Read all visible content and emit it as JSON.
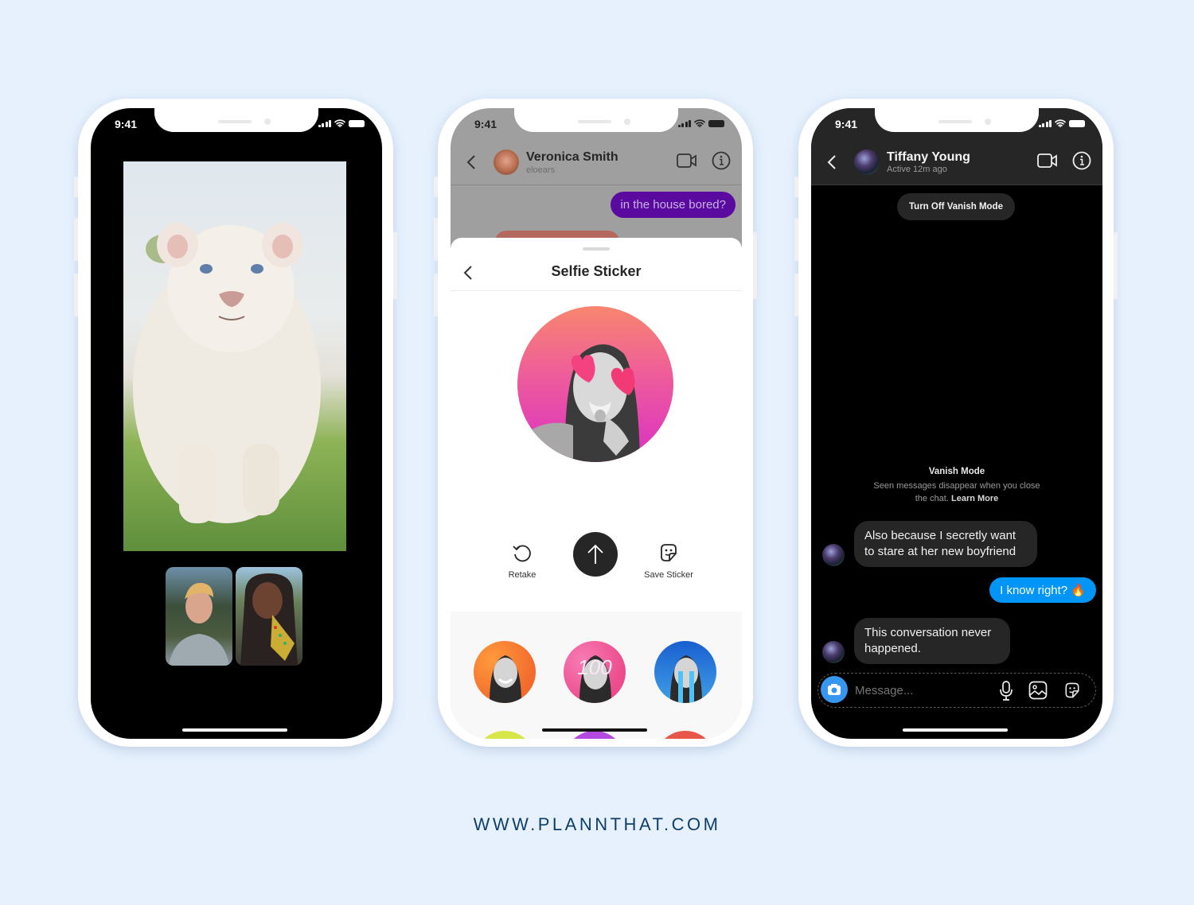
{
  "phones": {
    "video_call": {
      "status_time": "9:41",
      "main_video_subject": "white lion cub on grass",
      "participants": [
        {
          "label": "participant-1",
          "description": "person with blond hair"
        },
        {
          "label": "participant-2",
          "description": "person with braided hair and AR hand effect"
        }
      ]
    },
    "selfie_sticker": {
      "status_time": "9:41",
      "contact_name": "Veronica Smith",
      "contact_username": "eloears",
      "sent_message": "in the house bored?",
      "sent_color": "#6a0dad",
      "sheet_title": "Selfie Sticker",
      "actions": {
        "retake_label": "Retake",
        "save_label": "Save Sticker"
      },
      "sticker_options": [
        {
          "name": "orange-flame",
          "color": "#f26b2d"
        },
        {
          "name": "pink-100",
          "color": "#ec4c8c",
          "overlay_text": "100"
        },
        {
          "name": "blue-tears",
          "color": "#1a6fd4"
        }
      ]
    },
    "vanish_mode": {
      "status_time": "9:41",
      "contact_name": "Tiffany Young",
      "contact_status": "Active 12m ago",
      "turn_off_label": "Turn Off Vanish Mode",
      "info_title": "Vanish Mode",
      "info_text": "Seen messages disappear when you close the chat.",
      "learn_more": "Learn More",
      "messages": [
        {
          "from": "them",
          "text": "Also because I secretly want to stare at her new boyfriend"
        },
        {
          "from": "me",
          "text": "I know right? 🔥"
        },
        {
          "from": "them",
          "text": "This conversation never happened."
        }
      ],
      "composer_placeholder": "Message...",
      "accent": "#0095f6"
    }
  },
  "footer": {
    "url": "WWW.PLANNTHAT.COM"
  }
}
